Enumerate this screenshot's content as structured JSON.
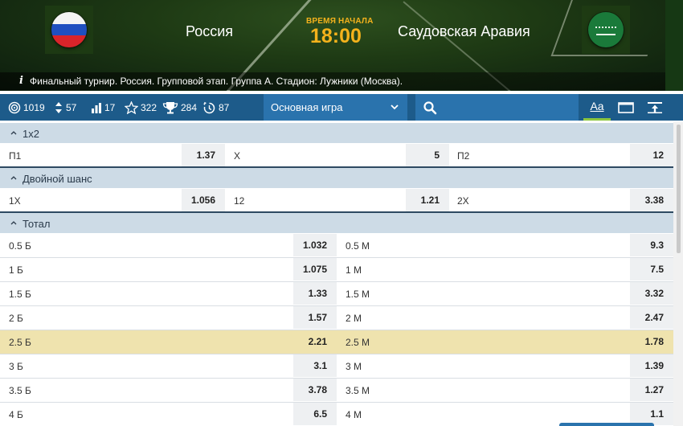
{
  "header": {
    "home_team": "Россия",
    "away_team": "Саудовская Аравия",
    "start_label": "ВРЕМЯ НАЧАЛА",
    "start_time": "18:00",
    "info": "Финальный турнир. Россия. Групповой этап. Группа А. Стадион: Лужники (Москва)."
  },
  "toolbar": {
    "counts": [
      {
        "icon": "all-markets-icon",
        "value": "1019"
      },
      {
        "icon": "sort-arrows-icon",
        "value": "57"
      },
      {
        "icon": "bars-icon",
        "value": "17"
      },
      {
        "icon": "star-icon",
        "value": "322"
      },
      {
        "icon": "trophy-icon",
        "value": "284"
      },
      {
        "icon": "timer-icon",
        "value": "87"
      }
    ],
    "market_select": "Основная игра",
    "search_placeholder": ""
  },
  "markets": {
    "1x2": {
      "title": "1x2",
      "cells": [
        {
          "label": "П1",
          "odd": "1.37"
        },
        {
          "label": "X",
          "odd": "5"
        },
        {
          "label": "П2",
          "odd": "12"
        }
      ]
    },
    "double": {
      "title": "Двойной шанс",
      "cells": [
        {
          "label": "1X",
          "odd": "1.056"
        },
        {
          "label": "12",
          "odd": "1.21"
        },
        {
          "label": "2X",
          "odd": "3.38"
        }
      ]
    },
    "total": {
      "title": "Тотал",
      "rows": [
        {
          "over": "0.5 Б",
          "over_odd": "1.032",
          "under": "0.5 М",
          "under_odd": "9.3"
        },
        {
          "over": "1 Б",
          "over_odd": "1.075",
          "under": "1 М",
          "under_odd": "7.5"
        },
        {
          "over": "1.5 Б",
          "over_odd": "1.33",
          "under": "1.5 М",
          "under_odd": "3.32"
        },
        {
          "over": "2 Б",
          "over_odd": "1.57",
          "under": "2 М",
          "under_odd": "2.47"
        },
        {
          "over": "2.5 Б",
          "over_odd": "2.21",
          "under": "2.5 М",
          "under_odd": "1.78"
        },
        {
          "over": "3 Б",
          "over_odd": "3.1",
          "under": "3 М",
          "under_odd": "1.39"
        },
        {
          "over": "3.5 Б",
          "over_odd": "3.78",
          "under": "3.5 М",
          "under_odd": "1.27"
        },
        {
          "over": "4 Б",
          "over_odd": "6.5",
          "under": "4 М",
          "under_odd": "1.1"
        }
      ]
    }
  },
  "colors": {
    "accent": "#f4b21c",
    "toolbar": "#1d5b8a",
    "section": "#cddbe6",
    "highlight": "#efe3ae"
  }
}
